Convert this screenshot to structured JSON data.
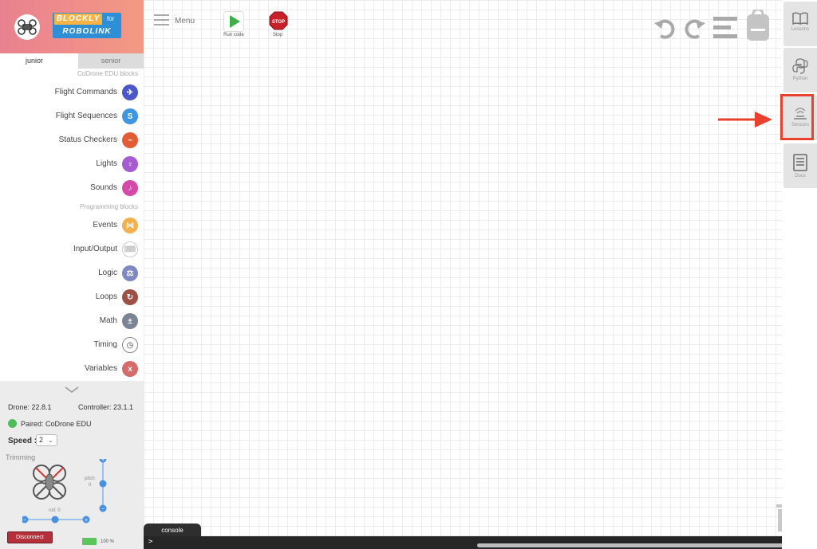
{
  "header": {
    "logo_blockly": "BLOCKLY",
    "logo_for": "for",
    "logo_robolink": "ROBOLINK"
  },
  "tabs": {
    "junior": "junior",
    "senior": "senior"
  },
  "sections": {
    "codrone": "CoDrone EDU blocks",
    "programming": "Programming blocks"
  },
  "categories": [
    {
      "label": "Flight Commands",
      "icon": "drone-icon",
      "color": "#4a56c9"
    },
    {
      "label": "Flight Sequences",
      "icon": "sequence-icon",
      "color": "#3d97e0"
    },
    {
      "label": "Status Checkers",
      "icon": "pulse-icon",
      "color": "#e25d35"
    },
    {
      "label": "Lights",
      "icon": "bulb-icon",
      "color": "#a65bd0"
    },
    {
      "label": "Sounds",
      "icon": "speaker-icon",
      "color": "#d549a8"
    },
    {
      "label": "Events",
      "icon": "share-icon",
      "color": "#f2b14a"
    },
    {
      "label": "Input/Output",
      "icon": "keyboard-icon",
      "color": "#c9c9c9"
    },
    {
      "label": "Logic",
      "icon": "scale-icon",
      "color": "#7e88c2"
    },
    {
      "label": "Loops",
      "icon": "loop-icon",
      "color": "#9e4f46"
    },
    {
      "label": "Math",
      "icon": "plus-minus-icon",
      "color": "#7a8494"
    },
    {
      "label": "Timing",
      "icon": "clock-icon",
      "color": "#8a8a8a"
    },
    {
      "label": "Variables",
      "icon": "variable-icon",
      "color": "#d56b6b"
    }
  ],
  "status": {
    "drone": "Drone: 22.8.1",
    "controller": "Controller: 23.1.1",
    "paired": "Paired: CoDrone EDU",
    "speed_label": "Speed :",
    "speed_value": "2",
    "trimming": "Trimming",
    "pitch_label": "pitch",
    "pitch_value": "0",
    "roll_label": "roll: 0",
    "disconnect": "Disconnect",
    "battery": "100 %",
    "battery_level": 1.0
  },
  "toolbar": {
    "menu": "Menu",
    "run": "Run code",
    "stop": "Stop",
    "stop_sign": "STOP"
  },
  "right_panel": {
    "lessons": "Lessons",
    "python": "Python",
    "sensors": "Sensors",
    "docs": "Docs"
  },
  "console": {
    "tab": "console",
    "prompt": ">"
  },
  "colors": {
    "accent_red": "#e8422f",
    "run_green": "#3fae49",
    "stop_red": "#c8202a"
  }
}
